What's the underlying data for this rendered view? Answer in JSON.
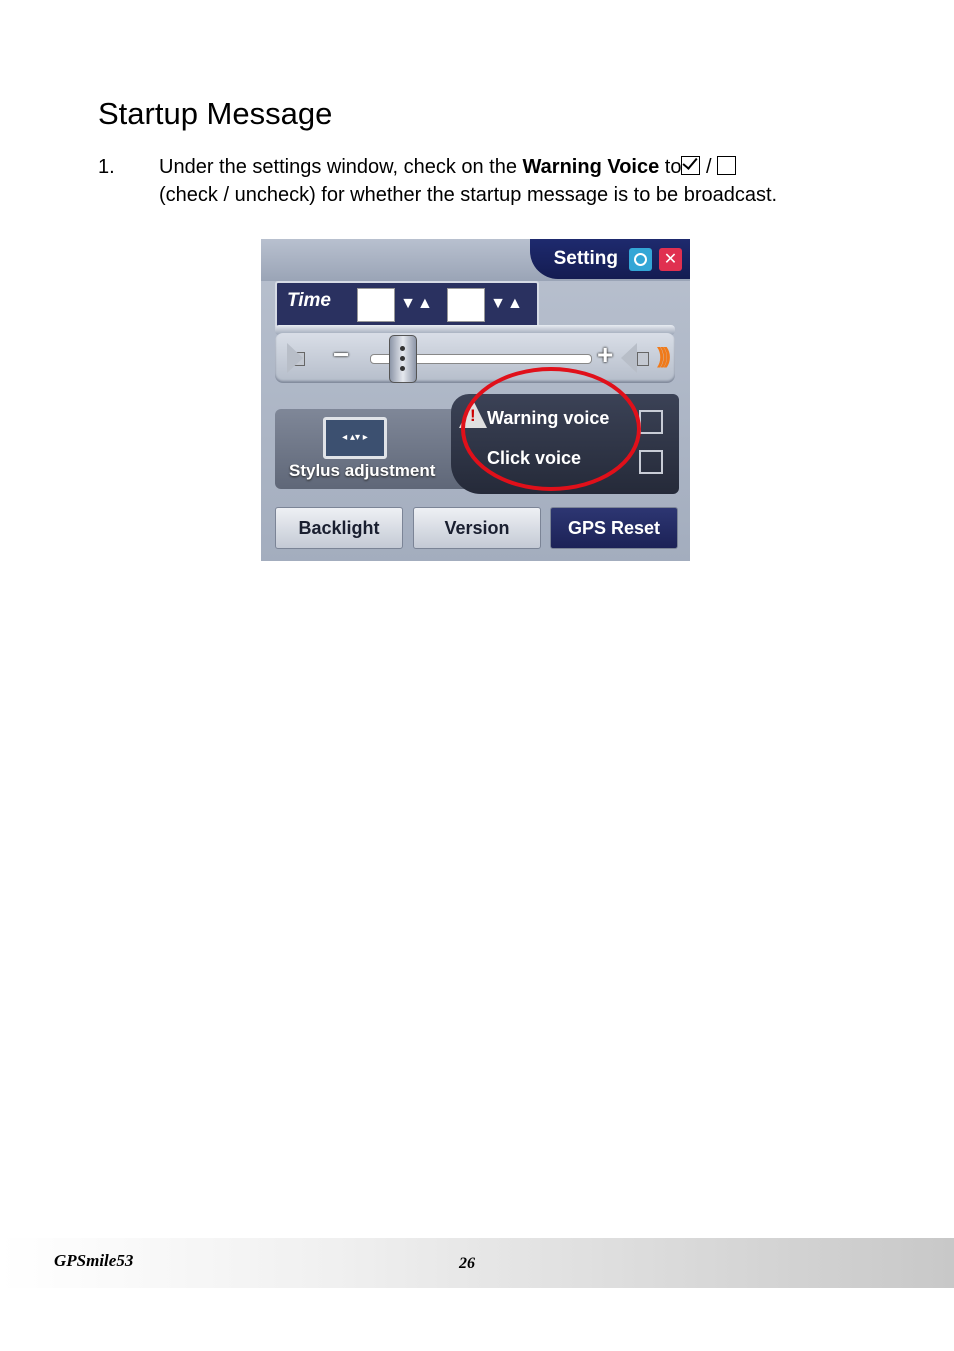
{
  "section_title": "Startup Message",
  "step": {
    "number": "1.",
    "text_before": "Under the settings window, check on the ",
    "bold_term": "Warning Voice",
    "text_to": " to",
    "separator": " / ",
    "text_after": "(check / uncheck) for whether the startup message is to be broadcast."
  },
  "settings_window": {
    "title": "Setting",
    "close_glyph": "✕",
    "time_label": "Time",
    "time_arrows": "▼▲",
    "volume_minus": "−",
    "volume_plus": "+",
    "volume_waves": ")))",
    "volume_level": 0.1,
    "stylus_label": "Stylus adjustment",
    "stylus_icon_glyph": "◂ ▴▾ ▸",
    "warning_icon_glyph": "!",
    "warning_voice_label": "Warning voice",
    "click_voice_label": "Click voice",
    "buttons": {
      "backlight": "Backlight",
      "version": "Version",
      "gps_reset": "GPS Reset"
    },
    "highlight_color": "#e0101a"
  },
  "footer": {
    "brand": "GPSmile53",
    "page_number": "26"
  }
}
